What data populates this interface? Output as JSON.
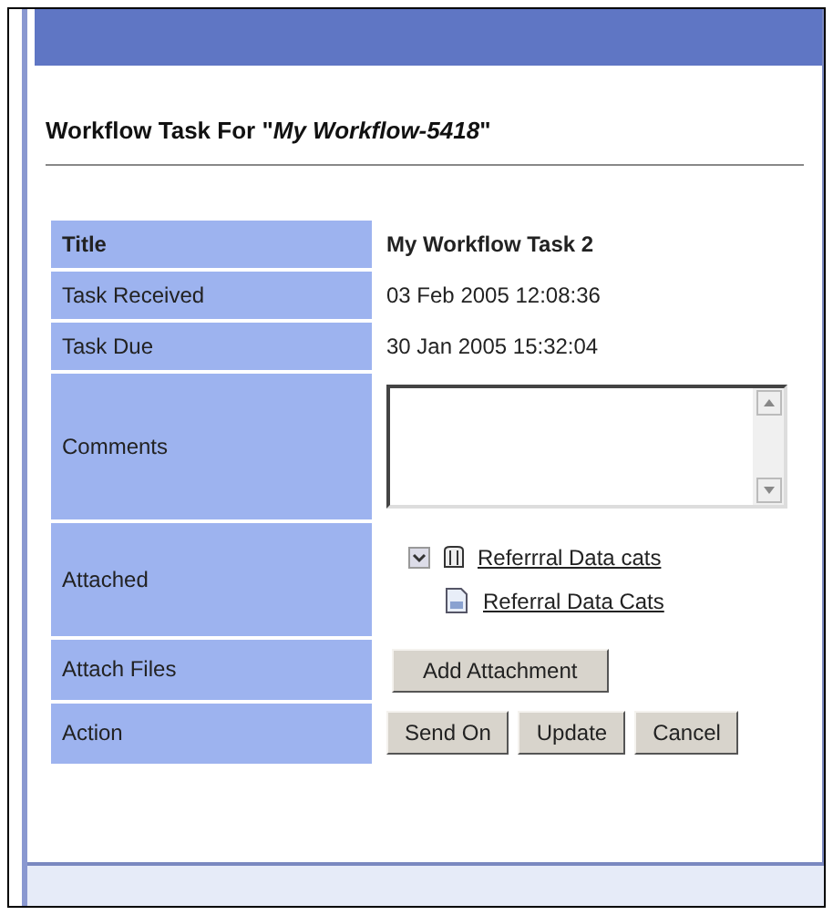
{
  "heading": "Workflow Task For \"*My Workflow-5418*\"",
  "rows": [
    {
      "label": "Title",
      "kind": "title",
      "value": "My Workflow Task 2"
    },
    {
      "label": "Task Received",
      "kind": "text",
      "value": "03 Feb 2005 12:08:36"
    },
    {
      "label": "Task Due",
      "kind": "text",
      "value": "30 Jan 2005 15:32:04"
    },
    {
      "label": "Comments",
      "kind": "textarea"
    },
    {
      "label": "Attached",
      "kind": "tree",
      "tree": [
        {
          "label": "Referrral Data cats",
          "expanded": true,
          "children": [
            {
              "label": "Referral Data Cats"
            }
          ]
        }
      ]
    },
    {
      "label": "Attach Files",
      "kind": "buttons",
      "buttons": [
        "Add Attachment"
      ]
    },
    {
      "label": "Action",
      "kind": "buttons",
      "buttons": [
        "Send On",
        "Update",
        "Cancel"
      ]
    }
  ]
}
